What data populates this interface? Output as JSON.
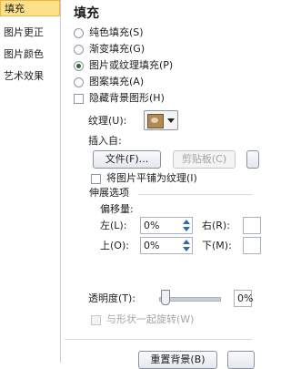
{
  "sidebar": {
    "items": [
      {
        "label": "填充",
        "active": true
      },
      {
        "label": "图片更正"
      },
      {
        "label": "图片颜色"
      },
      {
        "label": "艺术效果"
      }
    ]
  },
  "fill": {
    "title": "填充",
    "options": [
      {
        "label": "纯色填充(S)",
        "checked": false
      },
      {
        "label": "渐变填充(G)",
        "checked": false
      },
      {
        "label": "图片或纹理填充(P)",
        "checked": true
      },
      {
        "label": "图案填充(A)",
        "checked": false
      }
    ],
    "hide_background_label": "隐藏背景图形(H)",
    "texture_label": "纹理(U):",
    "insert_from_label": "插入自:",
    "file_button": "文件(F)...",
    "clipboard_button": "剪贴板(C)",
    "tile_label": "将图片平铺为纹理(I)",
    "stretch_title": "伸展选项",
    "offset_title": "偏移量:",
    "left_label": "左(L):",
    "left_value": "0%",
    "right_label": "右(R):",
    "top_label": "上(O):",
    "top_value": "0%",
    "bottom_label": "下(M):",
    "transparency_label": "透明度(T):",
    "transparency_value": "0%",
    "transparency_level": 0,
    "rotate_label": "与形状一起旋转(W)",
    "reset_button": "重置背景(B)"
  },
  "colors": {
    "accent": "#2d69a8",
    "active_item": "#fce08a"
  }
}
